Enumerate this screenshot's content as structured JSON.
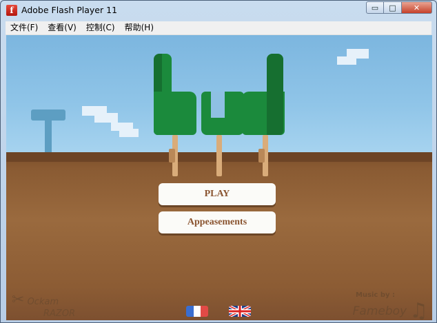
{
  "window": {
    "title": "Adobe Flash Player 11",
    "icon": "flash-icon",
    "controls": {
      "minimize": "▭",
      "maximize": "□",
      "close": "✕"
    }
  },
  "menu": {
    "items": [
      "文件(F)",
      "查看(V)",
      "控制(C)",
      "帮助(H)"
    ]
  },
  "game": {
    "logo_letters": [
      "b",
      "u",
      "d"
    ],
    "buttons": {
      "play": "PLAY",
      "appeasements": "Appeasements"
    },
    "credits": {
      "left_line1": "Ockam",
      "left_line2": "RAZOR",
      "right_label": "Music by :",
      "right_name": "Fameboy",
      "music_icon": "music-note-icon"
    },
    "languages": [
      "french-flag",
      "uk-flag"
    ]
  },
  "colors": {
    "sky": "#90c5e8",
    "ground": "#9a6a3e",
    "logo_green": "#1b8a3c",
    "button_text": "#8a5430"
  }
}
